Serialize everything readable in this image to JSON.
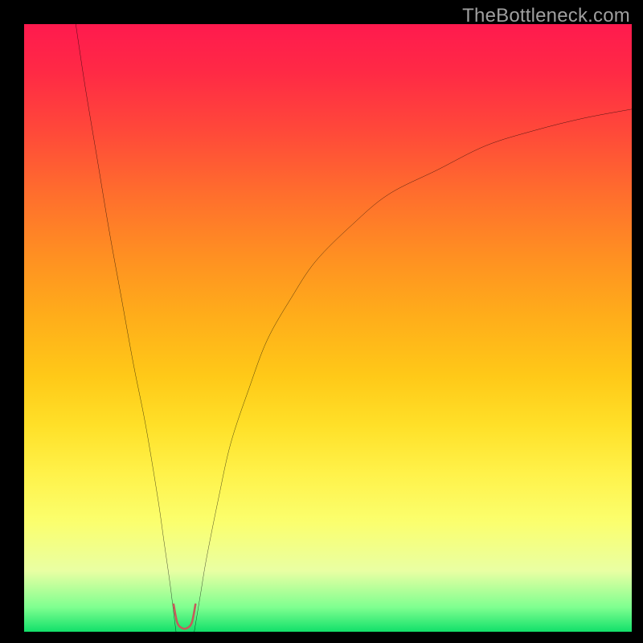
{
  "watermark": "TheBottleneck.com",
  "colors": {
    "page_bg": "#000000",
    "curve_stroke": "#000000",
    "minimum_marker": "#c55b5b"
  },
  "chart_data": {
    "type": "line",
    "title": "",
    "xlabel": "",
    "ylabel": "",
    "xlim": [
      0,
      100
    ],
    "ylim": [
      0,
      100
    ],
    "grid": false,
    "legend": false,
    "series": [
      {
        "name": "left-branch",
        "x": [
          8.5,
          10,
          12,
          14,
          16,
          18,
          20,
          22,
          23,
          24,
          24.5,
          25
        ],
        "y": [
          100,
          90,
          78,
          66,
          55,
          44,
          34,
          22,
          15,
          8,
          4,
          0
        ]
      },
      {
        "name": "right-branch",
        "x": [
          28,
          29,
          30,
          32,
          34,
          37,
          40,
          44,
          48,
          54,
          60,
          68,
          76,
          84,
          92,
          100
        ],
        "y": [
          0,
          6,
          12,
          22,
          31,
          40,
          48,
          55,
          61,
          67,
          72,
          76,
          80,
          82.5,
          84.5,
          86
        ]
      },
      {
        "name": "minimum-well",
        "x": [
          24.6,
          25.2,
          26.0,
          26.8,
          27.6,
          28.2
        ],
        "y": [
          4.5,
          1.5,
          0.6,
          0.6,
          1.5,
          4.5
        ]
      }
    ]
  }
}
